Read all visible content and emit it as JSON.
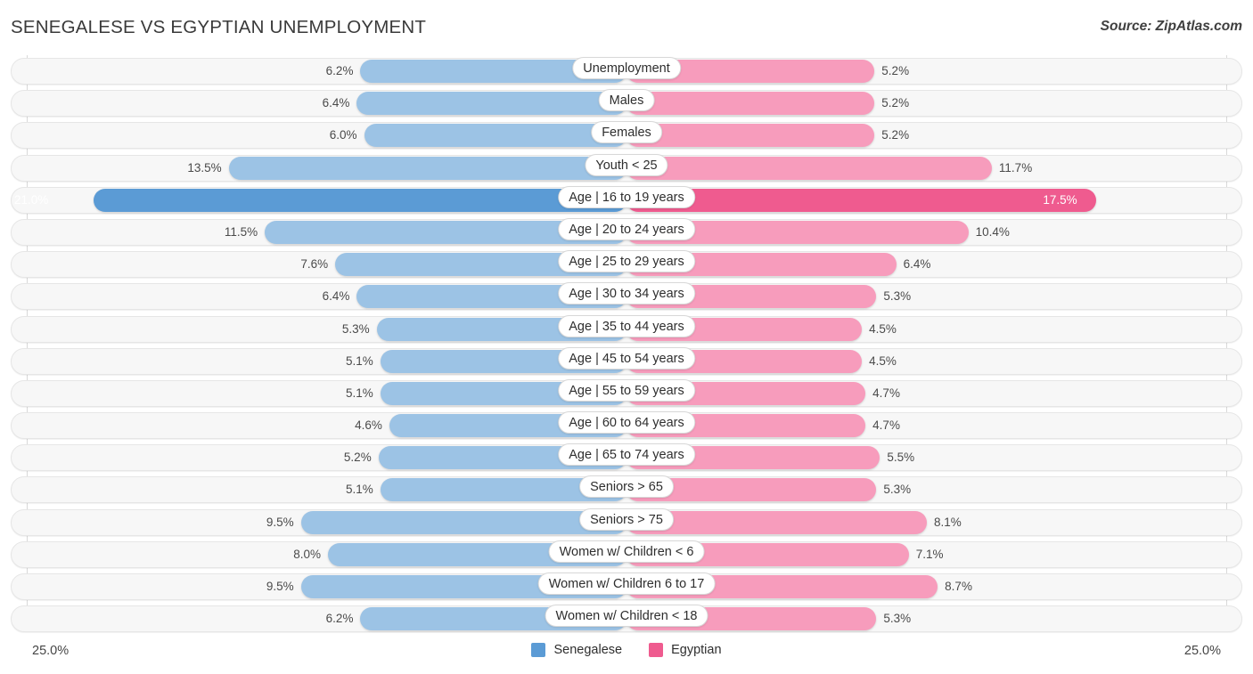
{
  "header": {
    "title": "SENEGALESE VS EGYPTIAN UNEMPLOYMENT",
    "source": "Source: ZipAtlas.com"
  },
  "axis": {
    "start_label": "25.0%",
    "end_label": "25.0%",
    "max": 25.0
  },
  "legend": {
    "items": [
      {
        "label": "Senegalese",
        "color": "#5b9bd5"
      },
      {
        "label": "Egyptian",
        "color": "#ef5b8f"
      }
    ]
  },
  "colors": {
    "left_normal": "#9cc3e5",
    "left_highlight": "#5b9bd5",
    "right_normal": "#f79cbc",
    "right_highlight": "#ef5b8f",
    "track": "#f7f7f7",
    "gridline": "#d9d9d9"
  },
  "chart_data": {
    "type": "bar",
    "orientation": "horizontal",
    "layout": "diverging-paired",
    "title": "SENEGALESE VS EGYPTIAN UNEMPLOYMENT",
    "xlabel": "",
    "ylabel": "",
    "xlim": [
      25.0,
      25.0
    ],
    "grid": true,
    "legend_position": "bottom-center",
    "categories": [
      "Unemployment",
      "Males",
      "Females",
      "Youth < 25",
      "Age | 16 to 19 years",
      "Age | 20 to 24 years",
      "Age | 25 to 29 years",
      "Age | 30 to 34 years",
      "Age | 35 to 44 years",
      "Age | 45 to 54 years",
      "Age | 55 to 59 years",
      "Age | 60 to 64 years",
      "Age | 65 to 74 years",
      "Seniors > 65",
      "Seniors > 75",
      "Women w/ Children < 6",
      "Women w/ Children 6 to 17",
      "Women w/ Children < 18"
    ],
    "series": [
      {
        "name": "Senegalese",
        "color": "#9cc3e5",
        "values": [
          6.2,
          6.4,
          6.0,
          13.5,
          21.0,
          11.5,
          7.6,
          6.4,
          5.3,
          5.1,
          5.1,
          4.6,
          5.2,
          5.1,
          9.5,
          8.0,
          9.5,
          6.2
        ],
        "labels": [
          "6.2%",
          "6.4%",
          "6.0%",
          "13.5%",
          "21.0%",
          "11.5%",
          "7.6%",
          "6.4%",
          "5.3%",
          "5.1%",
          "5.1%",
          "4.6%",
          "5.2%",
          "5.1%",
          "9.5%",
          "8.0%",
          "9.5%",
          "6.2%"
        ]
      },
      {
        "name": "Egyptian",
        "color": "#f79cbc",
        "values": [
          5.2,
          5.2,
          5.2,
          11.7,
          17.5,
          10.4,
          6.4,
          5.3,
          4.5,
          4.5,
          4.7,
          4.7,
          5.5,
          5.3,
          8.1,
          7.1,
          8.7,
          5.3
        ],
        "labels": [
          "5.2%",
          "5.2%",
          "5.2%",
          "11.7%",
          "17.5%",
          "10.4%",
          "6.4%",
          "5.3%",
          "4.5%",
          "4.5%",
          "4.7%",
          "4.7%",
          "5.5%",
          "5.3%",
          "8.1%",
          "7.1%",
          "8.7%",
          "5.3%"
        ]
      }
    ],
    "highlight_row_index": 4
  }
}
